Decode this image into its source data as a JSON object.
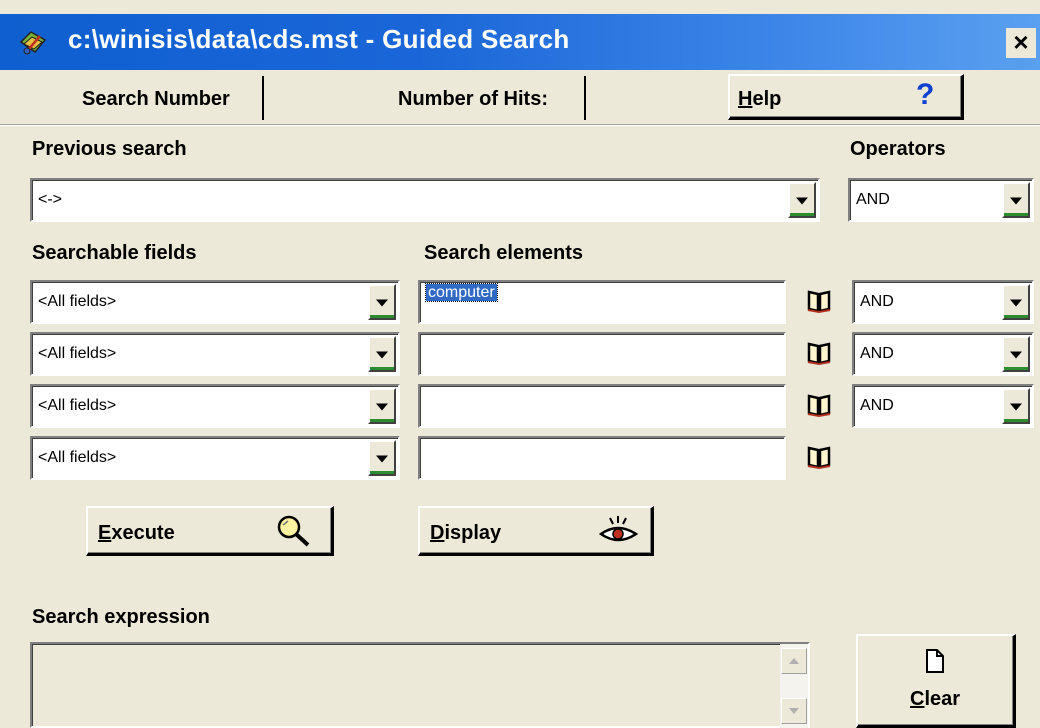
{
  "window": {
    "title": "c:\\winisis\\data\\cds.mst - Guided Search",
    "close_glyph": "×"
  },
  "toolbar": {
    "search_number_label": "Search Number",
    "search_number_value": "",
    "hits_label": "Number of Hits:",
    "hits_value": "",
    "help_first": "H",
    "help_rest": "elp",
    "help_glyph": "?"
  },
  "previous_search": {
    "label": "Previous search",
    "value": "<->"
  },
  "operators": {
    "label": "Operators",
    "top_value": "AND",
    "row_values": [
      "AND",
      "AND",
      "AND"
    ]
  },
  "fields": {
    "label": "Searchable fields",
    "values": [
      "<All fields>",
      "<All fields>",
      "<All fields>",
      "<All fields>"
    ]
  },
  "elements": {
    "label": "Search elements",
    "values": [
      "computer",
      "",
      "",
      ""
    ]
  },
  "actions": {
    "execute_first": "E",
    "execute_rest": "xecute",
    "display_first": "D",
    "display_rest": "isplay",
    "clear_first": "C",
    "clear_rest": "lear"
  },
  "expression": {
    "label": "Search expression",
    "value": ""
  },
  "icons": {
    "title": "winisis-app-icon",
    "book": "book-icon",
    "execute": "magnifier-icon",
    "display": "eye-icon",
    "clear": "document-icon",
    "help": "question-icon"
  },
  "colors": {
    "titlebar": "#0f5fd0",
    "selection": "#316ac5",
    "face": "#ece9d8"
  }
}
